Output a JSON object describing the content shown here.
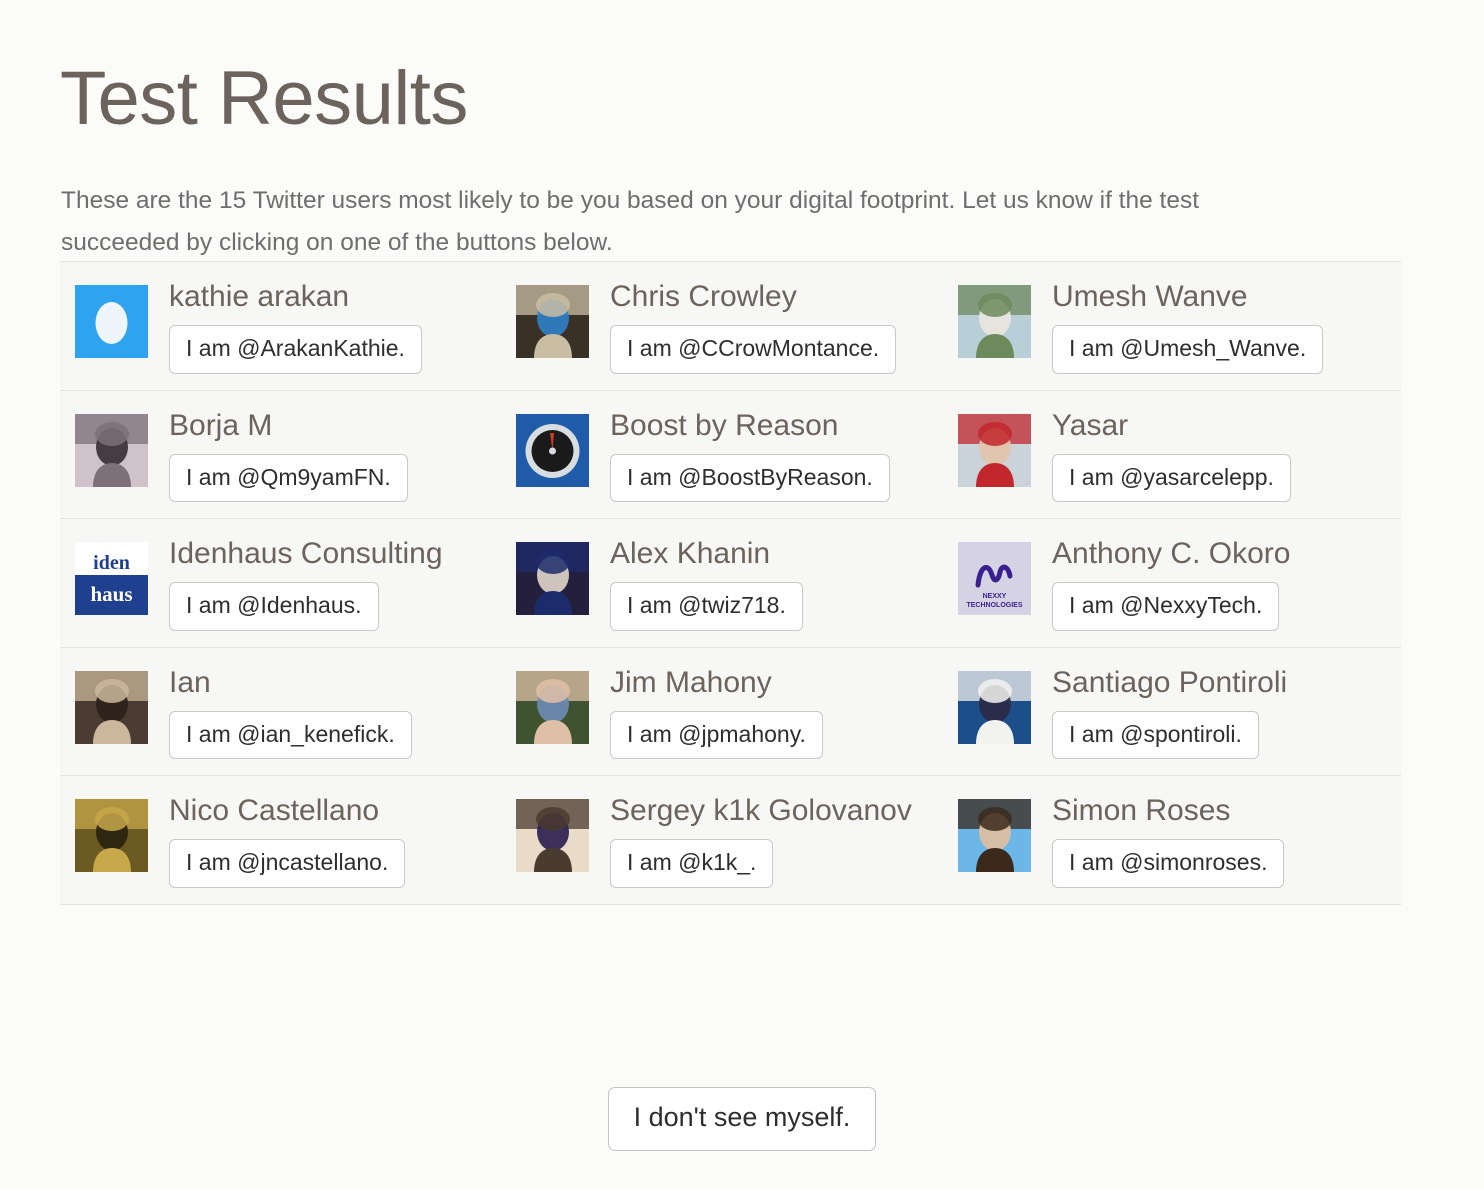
{
  "page": {
    "title": "Test Results",
    "intro": "These are the 15 Twitter users most likely to be you based on your digital footprint. Let us know if the test succeeded by clicking on one of the buttons below."
  },
  "results": [
    {
      "name": "kathie arakan",
      "handle_label": "I am @ArakanKathie.",
      "avatar": "twitter-egg-avatar",
      "avatar_colors": [
        "#2ea3ef",
        "#eff6fb"
      ]
    },
    {
      "name": "Chris Crowley",
      "handle_label": "I am @CCrowMontance.",
      "avatar": "photo-avatar-man-blue-shirt",
      "avatar_colors": [
        "#3a3126",
        "#c9bda3",
        "#2f7fc4"
      ]
    },
    {
      "name": "Umesh Wanve",
      "handle_label": "I am @Umesh_Wanve.",
      "avatar": "photo-avatar-man-at-pool",
      "avatar_colors": [
        "#b9cfd8",
        "#6d8a5c",
        "#e8e6e0"
      ]
    },
    {
      "name": "Borja M",
      "handle_label": "I am @Qm9yamFN.",
      "avatar": "photo-avatar-desk-scene",
      "avatar_colors": [
        "#cfc2c9",
        "#7e7079",
        "#3a3138"
      ]
    },
    {
      "name": "Boost by Reason",
      "handle_label": "I am @BoostByReason.",
      "avatar": "speedometer-gauge-avatar",
      "avatar_colors": [
        "#1f5ba8",
        "#d8dde2",
        "#1a1a1a",
        "#d03a2a"
      ]
    },
    {
      "name": "Yasar",
      "handle_label": "I am @yasarcelepp.",
      "avatar": "photo-avatar-man-red-jacket",
      "avatar_colors": [
        "#cbd3da",
        "#c2272d",
        "#e2c3ab"
      ]
    },
    {
      "name": "Idenhaus Consulting",
      "handle_label": "I am @Idenhaus.",
      "avatar": "idenhaus-logo",
      "avatar_colors": [
        "#ffffff",
        "#1f3f8f"
      ],
      "avatar_text": [
        "iden",
        "haus"
      ]
    },
    {
      "name": "Alex Khanin",
      "handle_label": "I am @twiz718.",
      "avatar": "photo-avatar-man-indoors",
      "avatar_colors": [
        "#241f3d",
        "#1c2b6b",
        "#ddd2c6"
      ]
    },
    {
      "name": "Anthony C. Okoro",
      "handle_label": "I am @NexxyTech.",
      "avatar": "nexxy-technologies-logo",
      "avatar_colors": [
        "#d5d2e4",
        "#3a1f8f"
      ],
      "avatar_text": [
        "NEXXY",
        "TECHNOLOGIES"
      ]
    },
    {
      "name": "Ian",
      "handle_label": "I am @ian_kenefick.",
      "avatar": "photo-avatar-man-sepia",
      "avatar_colors": [
        "#4a3c33",
        "#cbb79c",
        "#2b2119"
      ]
    },
    {
      "name": "Jim Mahony",
      "handle_label": "I am @jpmahony.",
      "avatar": "photo-avatar-man-sunglasses",
      "avatar_colors": [
        "#3f5330",
        "#dfc0a6",
        "#6d8bb4"
      ]
    },
    {
      "name": "Santiago Pontiroli",
      "handle_label": "I am @spontiroli.",
      "avatar": "photo-avatar-man-white-shirt-stage",
      "avatar_colors": [
        "#1c4f8a",
        "#f2f2ee",
        "#2a2a45"
      ]
    },
    {
      "name": "Nico Castellano",
      "handle_label": "I am @jncastellano.",
      "avatar": "photo-avatar-man-brown-suit",
      "avatar_colors": [
        "#6b5a22",
        "#c7a84a",
        "#2b2310"
      ]
    },
    {
      "name": "Sergey k1k Golovanov",
      "handle_label": "I am @k1k_.",
      "avatar": "photo-avatar-man-long-hair",
      "avatar_colors": [
        "#e8dcc8",
        "#4a3b2f",
        "#2e1f52"
      ]
    },
    {
      "name": "Simon Roses",
      "handle_label": "I am @simonroses.",
      "avatar": "photo-avatar-man-sunglasses-sky",
      "avatar_colors": [
        "#6cb7e8",
        "#3b2a1c",
        "#e0bfa0"
      ]
    }
  ],
  "footer": {
    "no_match_label": "I don't see myself."
  },
  "colors": {
    "page_background": "#fbfbfa",
    "panel_background": "#f7f7f6",
    "divider": "#e2e2e0",
    "heading_text": "#6b635c",
    "body_text": "#6e6e6e",
    "button_text": "#2e2e2e",
    "button_border": "#c9c9c7"
  }
}
